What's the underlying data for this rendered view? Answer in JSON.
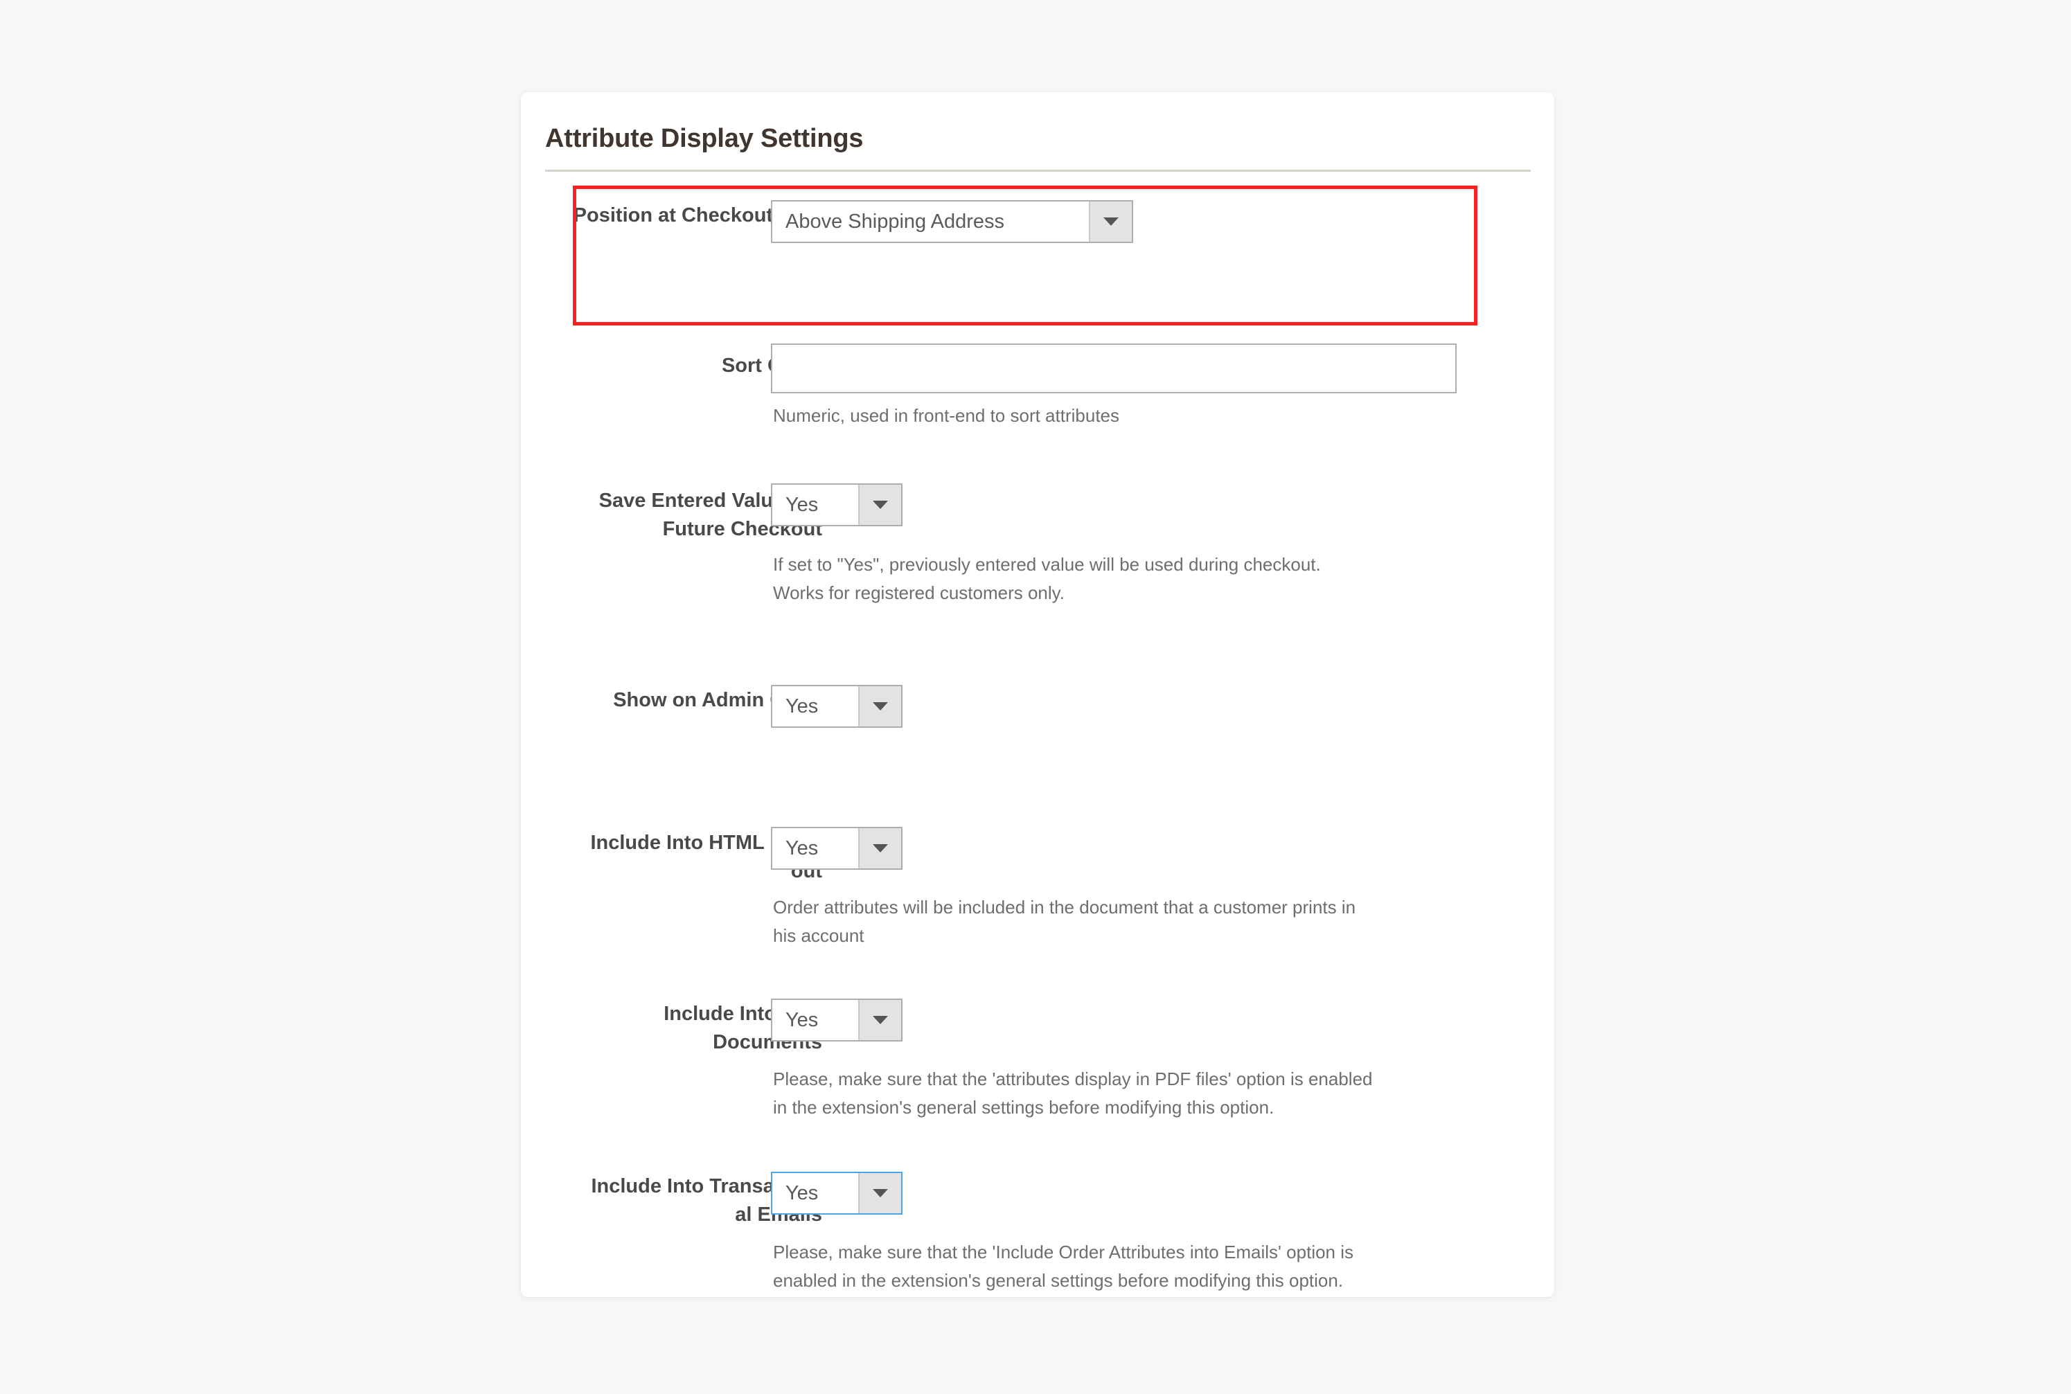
{
  "card": {
    "title": "Attribute Display Settings"
  },
  "fields": {
    "position_at_checkout_step": {
      "label": "Position at Checkout Step",
      "value": "Above Shipping Address",
      "control": "select"
    },
    "sort_order": {
      "label": "Sort Order",
      "value": "",
      "placeholder": "",
      "help": "Numeric, used in front-end to sort attributes",
      "control": "text"
    },
    "save_entered_value": {
      "label": "Save Entered Value For Future Checkout",
      "value": "Yes",
      "help": "If set to \"Yes\", previously entered value will be used during checkout.\nWorks for registered customers only.",
      "control": "select"
    },
    "show_on_admin_grids": {
      "label": "Show on Admin Grids",
      "value": "Yes",
      "help": "",
      "control": "select"
    },
    "include_into_html_printout": {
      "label": "Include Into HTML Print-out",
      "value": "Yes",
      "help": "Order attributes will be included in the document that a customer prints in\nhis account",
      "control": "select"
    },
    "include_into_pdf_documents": {
      "label": "Include Into PDF Documents",
      "value": "Yes",
      "help": "Please, make sure that the 'attributes display in PDF files' option is enabled\nin the extension's general settings before modifying this option.",
      "control": "select"
    },
    "include_into_transactional_emails": {
      "label": "Include Into Transaction al Emails",
      "value": "Yes",
      "help": "Please, make sure that the 'Include Order Attributes into Emails' option is\nenabled in the extension's general settings before modifying this option.",
      "control": "select",
      "focused": true
    }
  },
  "icons": {
    "dropdown_caret": "chevron-down-icon"
  },
  "colors": {
    "highlight_border": "#f92121",
    "focus_border": "#49a6e9",
    "card_background": "#ffffff",
    "page_background": "#f7f7f7",
    "label_text": "#494949",
    "help_text": "#6e6e6e",
    "title_text": "#41362f",
    "divider": "#d6d1cb"
  }
}
